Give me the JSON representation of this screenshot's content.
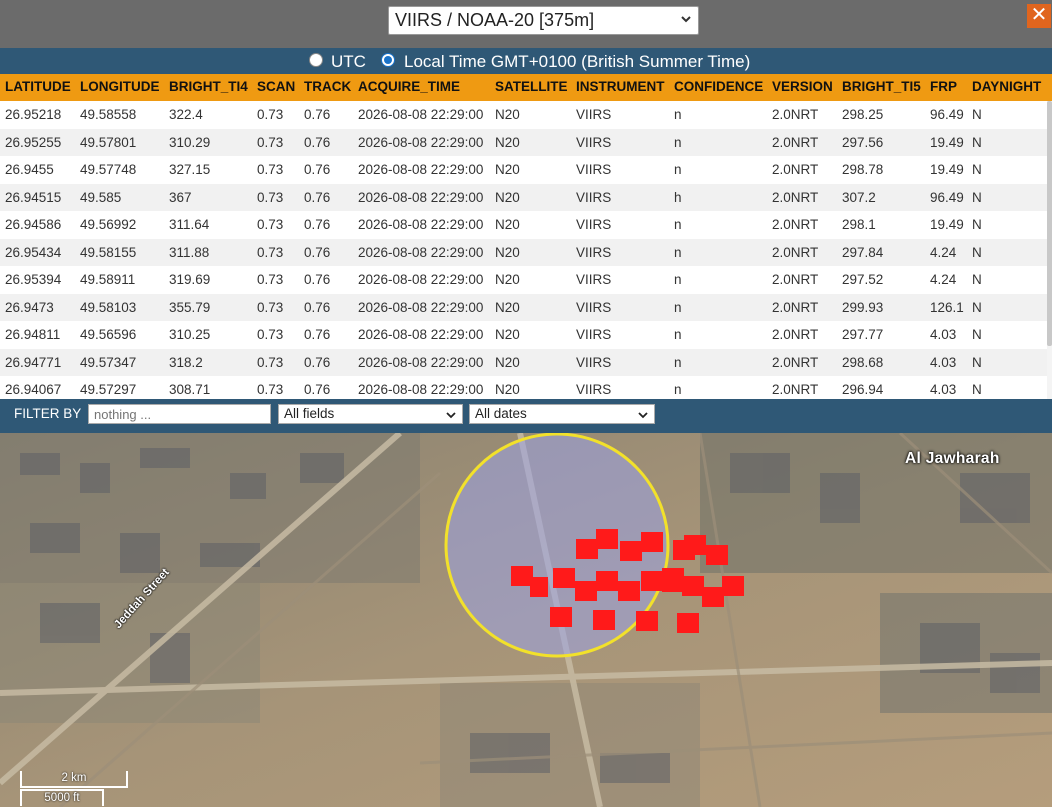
{
  "header": {
    "sensor_selected": "VIIRS / NOAA-20 [375m]",
    "close_label": "✕"
  },
  "time": {
    "utc_label": "UTC",
    "local_label": "Local Time GMT+0100 (British Summer Time)",
    "selected": "local"
  },
  "table": {
    "columns": [
      "LATITUDE",
      "LONGITUDE",
      "BRIGHT_TI4",
      "SCAN",
      "TRACK",
      "ACQUIRE_TIME",
      "SATELLITE",
      "INSTRUMENT",
      "CONFIDENCE",
      "VERSION",
      "BRIGHT_TI5",
      "FRP",
      "DAYNIGHT"
    ],
    "rows": [
      [
        "26.95218",
        "49.58558",
        "322.4",
        "0.73",
        "0.76",
        "2026-08-08 22:29:00",
        "N20",
        "VIIRS",
        "n",
        "2.0NRT",
        "298.25",
        "96.49",
        "N"
      ],
      [
        "26.95255",
        "49.57801",
        "310.29",
        "0.73",
        "0.76",
        "2026-08-08 22:29:00",
        "N20",
        "VIIRS",
        "n",
        "2.0NRT",
        "297.56",
        "19.49",
        "N"
      ],
      [
        "26.9455",
        "49.57748",
        "327.15",
        "0.73",
        "0.76",
        "2026-08-08 22:29:00",
        "N20",
        "VIIRS",
        "n",
        "2.0NRT",
        "298.78",
        "19.49",
        "N"
      ],
      [
        "26.94515",
        "49.585",
        "367",
        "0.73",
        "0.76",
        "2026-08-08 22:29:00",
        "N20",
        "VIIRS",
        "h",
        "2.0NRT",
        "307.2",
        "96.49",
        "N"
      ],
      [
        "26.94586",
        "49.56992",
        "311.64",
        "0.73",
        "0.76",
        "2026-08-08 22:29:00",
        "N20",
        "VIIRS",
        "n",
        "2.0NRT",
        "298.1",
        "19.49",
        "N"
      ],
      [
        "26.95434",
        "49.58155",
        "311.88",
        "0.73",
        "0.76",
        "2026-08-08 22:29:00",
        "N20",
        "VIIRS",
        "n",
        "2.0NRT",
        "297.84",
        "4.24",
        "N"
      ],
      [
        "26.95394",
        "49.58911",
        "319.69",
        "0.73",
        "0.76",
        "2026-08-08 22:29:00",
        "N20",
        "VIIRS",
        "n",
        "2.0NRT",
        "297.52",
        "4.24",
        "N"
      ],
      [
        "26.9473",
        "49.58103",
        "355.79",
        "0.73",
        "0.76",
        "2026-08-08 22:29:00",
        "N20",
        "VIIRS",
        "n",
        "2.0NRT",
        "299.93",
        "126.1",
        "N"
      ],
      [
        "26.94811",
        "49.56596",
        "310.25",
        "0.73",
        "0.76",
        "2026-08-08 22:29:00",
        "N20",
        "VIIRS",
        "n",
        "2.0NRT",
        "297.77",
        "4.03",
        "N"
      ],
      [
        "26.94771",
        "49.57347",
        "318.2",
        "0.73",
        "0.76",
        "2026-08-08 22:29:00",
        "N20",
        "VIIRS",
        "n",
        "2.0NRT",
        "298.68",
        "4.03",
        "N"
      ],
      [
        "26.94067",
        "49.57297",
        "308.71",
        "0.73",
        "0.76",
        "2026-08-08 22:29:00",
        "N20",
        "VIIRS",
        "n",
        "2.0NRT",
        "296.94",
        "4.03",
        "N"
      ]
    ]
  },
  "filter": {
    "label": "FILTER BY",
    "placeholder": "nothing ...",
    "fields_selected": "All fields",
    "dates_selected": "All dates"
  },
  "map": {
    "place_label": "Al Jawharah",
    "street_label": "Jeddah Street",
    "scale_km": "2 km",
    "scale_ft": "5000 ft",
    "hotspot_color": "#ff1a1a",
    "circle_color": "#f2e12a"
  }
}
